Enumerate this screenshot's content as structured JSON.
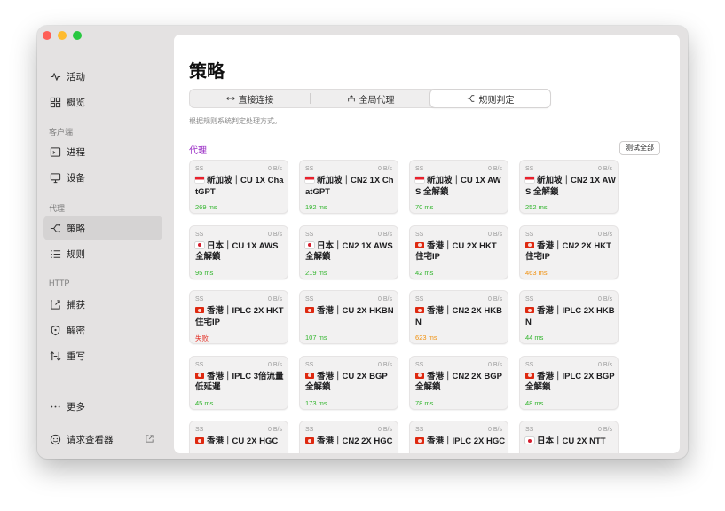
{
  "colors": {
    "accent_section": "#9b2fc6",
    "latency_good": "#33b52e",
    "latency_warn": "#f0900e",
    "latency_bad": "#e4352b"
  },
  "sidebar": {
    "items": [
      {
        "label": "活动",
        "icon": "activity-icon"
      },
      {
        "label": "概览",
        "icon": "grid-icon"
      }
    ],
    "client_section": "客户端",
    "client_items": [
      {
        "label": "进程",
        "icon": "process-icon"
      },
      {
        "label": "设备",
        "icon": "monitor-icon"
      }
    ],
    "proxy_section": "代理",
    "proxy_items": [
      {
        "label": "策略",
        "icon": "policy-icon",
        "active": true
      },
      {
        "label": "规则",
        "icon": "rules-icon"
      }
    ],
    "http_section": "HTTP",
    "http_items": [
      {
        "label": "捕获",
        "icon": "capture-icon"
      },
      {
        "label": "解密",
        "icon": "shield-icon"
      },
      {
        "label": "重写",
        "icon": "rewrite-icon"
      }
    ],
    "more_label": "更多",
    "request_viewer_label": "请求查看器"
  },
  "main": {
    "title": "策略",
    "modes": [
      {
        "label": "直接连接",
        "icon": "direct-icon"
      },
      {
        "label": "全局代理",
        "icon": "global-icon"
      },
      {
        "label": "规则判定",
        "icon": "rule-icon",
        "selected": true
      }
    ],
    "hint": "根据规则系统判定处理方式。",
    "section_title": "代理",
    "test_all_label": "测试全部",
    "cards": [
      {
        "type": "SS",
        "rate": "0 B/s",
        "flag": "sg",
        "name": "新加坡｜CU 1X ChatGPT",
        "latency": "269 ms",
        "status": "good"
      },
      {
        "type": "SS",
        "rate": "0 B/s",
        "flag": "sg",
        "name": "新加坡｜CN2 1X ChatGPT",
        "latency": "192 ms",
        "status": "good"
      },
      {
        "type": "SS",
        "rate": "0 B/s",
        "flag": "sg",
        "name": "新加坡｜CU 1X AWS 全解鎖",
        "latency": "70 ms",
        "status": "good"
      },
      {
        "type": "SS",
        "rate": "0 B/s",
        "flag": "sg",
        "name": "新加坡｜CN2 1X AWS 全解鎖",
        "latency": "252 ms",
        "status": "good"
      },
      {
        "type": "SS",
        "rate": "0 B/s",
        "flag": "jp",
        "name": "日本｜CU 1X AWS 全解鎖",
        "latency": "95 ms",
        "status": "good"
      },
      {
        "type": "SS",
        "rate": "0 B/s",
        "flag": "jp",
        "name": "日本｜CN2 1X AWS 全解鎖",
        "latency": "219 ms",
        "status": "good"
      },
      {
        "type": "SS",
        "rate": "0 B/s",
        "flag": "hk",
        "name": "香港｜CU 2X HKT 住宅IP",
        "latency": "42 ms",
        "status": "good"
      },
      {
        "type": "SS",
        "rate": "0 B/s",
        "flag": "hk",
        "name": "香港｜CN2 2X HKT 住宅IP",
        "latency": "463 ms",
        "status": "warn"
      },
      {
        "type": "SS",
        "rate": "0 B/s",
        "flag": "hk",
        "name": "香港｜IPLC 2X HKT 住宅IP",
        "latency": "失败",
        "status": "bad"
      },
      {
        "type": "SS",
        "rate": "0 B/s",
        "flag": "hk",
        "name": "香港｜CU 2X HKBN",
        "latency": "107 ms",
        "status": "good"
      },
      {
        "type": "SS",
        "rate": "0 B/s",
        "flag": "hk",
        "name": "香港｜CN2 2X HKBN",
        "latency": "623 ms",
        "status": "warn"
      },
      {
        "type": "SS",
        "rate": "0 B/s",
        "flag": "hk",
        "name": "香港｜IPLC 2X HKBN",
        "latency": "44 ms",
        "status": "good"
      },
      {
        "type": "SS",
        "rate": "0 B/s",
        "flag": "hk",
        "name": "香港｜IPLC 3倍流量 低延遲",
        "latency": "45 ms",
        "status": "good"
      },
      {
        "type": "SS",
        "rate": "0 B/s",
        "flag": "hk",
        "name": "香港｜CU 2X BGP 全解鎖",
        "latency": "173 ms",
        "status": "good"
      },
      {
        "type": "SS",
        "rate": "0 B/s",
        "flag": "hk",
        "name": "香港｜CN2 2X BGP 全解鎖",
        "latency": "78 ms",
        "status": "good"
      },
      {
        "type": "SS",
        "rate": "0 B/s",
        "flag": "hk",
        "name": "香港｜IPLC 2X BGP 全解鎖",
        "latency": "48 ms",
        "status": "good"
      },
      {
        "type": "SS",
        "rate": "0 B/s",
        "flag": "hk",
        "name": "香港｜CU 2X HGC",
        "latency": "",
        "status": "good"
      },
      {
        "type": "SS",
        "rate": "0 B/s",
        "flag": "hk",
        "name": "香港｜CN2 2X HGC",
        "latency": "",
        "status": "good"
      },
      {
        "type": "SS",
        "rate": "0 B/s",
        "flag": "hk",
        "name": "香港｜IPLC 2X HGC",
        "latency": "",
        "status": "good"
      },
      {
        "type": "SS",
        "rate": "0 B/s",
        "flag": "jp",
        "name": "日本｜CU 2X NTT",
        "latency": "",
        "status": "good"
      }
    ]
  }
}
